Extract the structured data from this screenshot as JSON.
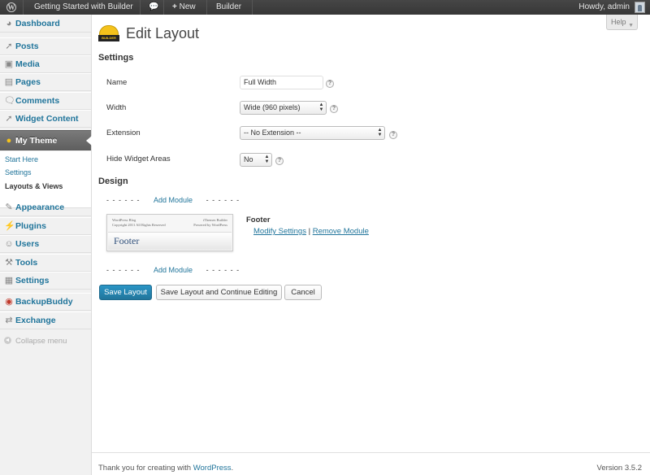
{
  "adminbar": {
    "site_name": "Getting Started with Builder",
    "new_label": "New",
    "builder_label": "Builder",
    "howdy": "Howdy, admin"
  },
  "sidebar": {
    "items": [
      {
        "label": "Dashboard",
        "icon": "dashboard-icon"
      },
      {
        "label": "Posts",
        "icon": "pin-icon"
      },
      {
        "label": "Media",
        "icon": "media-icon"
      },
      {
        "label": "Pages",
        "icon": "pages-icon"
      },
      {
        "label": "Comments",
        "icon": "comment-icon"
      },
      {
        "label": "Widget Content",
        "icon": "pin-icon"
      },
      {
        "label": "My Theme",
        "icon": "builder-hat-icon"
      },
      {
        "label": "Appearance",
        "icon": "appearance-icon"
      },
      {
        "label": "Plugins",
        "icon": "plugin-icon"
      },
      {
        "label": "Users",
        "icon": "users-icon"
      },
      {
        "label": "Tools",
        "icon": "tools-icon"
      },
      {
        "label": "Settings",
        "icon": "settings-icon"
      },
      {
        "label": "BackupBuddy",
        "icon": "backup-icon"
      },
      {
        "label": "Exchange",
        "icon": "exchange-icon"
      }
    ],
    "submenu": [
      "Start Here",
      "Settings",
      "Layouts & Views"
    ],
    "collapse_label": "Collapse menu"
  },
  "help_label": "Help",
  "page_title": "Edit Layout",
  "settings": {
    "heading": "Settings",
    "name_label": "Name",
    "name_value": "Full Width",
    "width_label": "Width",
    "width_value": "Wide (960 pixels)",
    "extension_label": "Extension",
    "extension_value": "-- No Extension --",
    "hide_label": "Hide Widget Areas",
    "hide_value": "No"
  },
  "design": {
    "heading": "Design",
    "dashes": "- - - - - -",
    "add_module": "Add Module",
    "module_title": "Footer",
    "modify_settings": "Modify Settings",
    "separator": "|",
    "remove_module": "Remove Module",
    "preview": {
      "blog_name": "WordPress Blog",
      "copyright": "Copyright 2011 All Rights Reserved",
      "builder_credit": "iThemes Builder",
      "powered": "Powered by WordPress",
      "footer_text": "Footer"
    }
  },
  "buttons": {
    "save": "Save Layout",
    "save_continue": "Save Layout and Continue Editing",
    "cancel": "Cancel"
  },
  "footer": {
    "thank_you": "Thank you for creating with",
    "wordpress_link": "WordPress",
    "period": ".",
    "version": "Version 3.5.2"
  },
  "colors": {
    "link": "#21759b",
    "primary_button": "#21759b",
    "active_menu": "#6d6d6d"
  }
}
